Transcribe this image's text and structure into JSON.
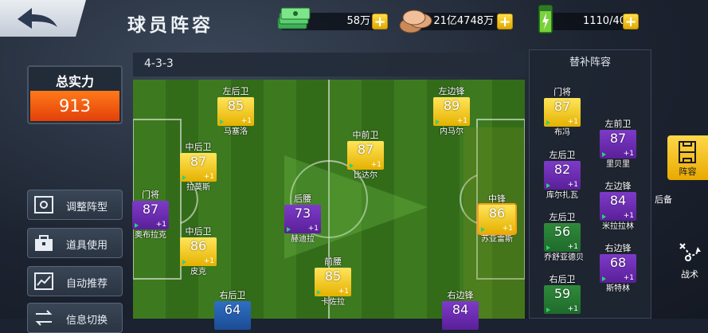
{
  "header": {
    "title": "球员阵容",
    "money": "58万",
    "coins": "21亿4748万",
    "energy": "1110/40"
  },
  "left": {
    "power_label": "总实力",
    "power_value": "913",
    "buttons": [
      "调整阵型",
      "道具使用",
      "自动推荐",
      "信息切换"
    ]
  },
  "formation": "4-3-3",
  "players": [
    {
      "pos": "左后卫",
      "rating": "85",
      "level": "+1",
      "name": "马塞洛",
      "color": "gold"
    },
    {
      "pos": "左边锋",
      "rating": "89",
      "level": "+1",
      "name": "内马尔",
      "color": "gold"
    },
    {
      "pos": "中后卫",
      "rating": "87",
      "level": "+1",
      "name": "拉莫斯",
      "color": "gold"
    },
    {
      "pos": "中前卫",
      "rating": "87",
      "level": "+1",
      "name": "比达尔",
      "color": "gold"
    },
    {
      "pos": "门将",
      "rating": "87",
      "level": "+1",
      "name": "奥布拉克",
      "color": "purple"
    },
    {
      "pos": "后腰",
      "rating": "73",
      "level": "+1",
      "name": "赫迪拉",
      "color": "purple"
    },
    {
      "pos": "中锋",
      "rating": "86",
      "level": "+1",
      "name": "苏亚雷斯",
      "color": "gold"
    },
    {
      "pos": "中后卫",
      "rating": "86",
      "level": "+1",
      "name": "皮克",
      "color": "gold"
    },
    {
      "pos": "前腰",
      "rating": "85",
      "level": "+1",
      "name": "卡佐拉",
      "color": "gold"
    },
    {
      "pos": "右后卫",
      "rating": "64",
      "level": "",
      "name": "",
      "color": "blue"
    },
    {
      "pos": "右边锋",
      "rating": "84",
      "level": "",
      "name": "",
      "color": "purple"
    }
  ],
  "subs": {
    "title": "替补阵容",
    "players": [
      {
        "pos": "门将",
        "rating": "87",
        "level": "+1",
        "name": "布冯",
        "color": "gold"
      },
      {
        "pos": "左前卫",
        "rating": "87",
        "level": "+1",
        "name": "里贝里",
        "color": "purple"
      },
      {
        "pos": "左后卫",
        "rating": "82",
        "level": "+1",
        "name": "库尔扎瓦",
        "color": "purple"
      },
      {
        "pos": "左边锋",
        "rating": "84",
        "level": "+1",
        "name": "米拉拉林",
        "color": "purple"
      },
      {
        "pos": "左后卫",
        "rating": "56",
        "level": "+1",
        "name": "乔舒亚德贝",
        "color": "green"
      },
      {
        "pos": "右边锋",
        "rating": "68",
        "level": "+1",
        "name": "斯特林",
        "color": "purple"
      },
      {
        "pos": "右后卫",
        "rating": "59",
        "level": "+1",
        "name": "",
        "color": "green"
      }
    ]
  },
  "right": {
    "tab_lineup": "阵容",
    "label_bench": "后备",
    "label_tactics": "战术"
  }
}
